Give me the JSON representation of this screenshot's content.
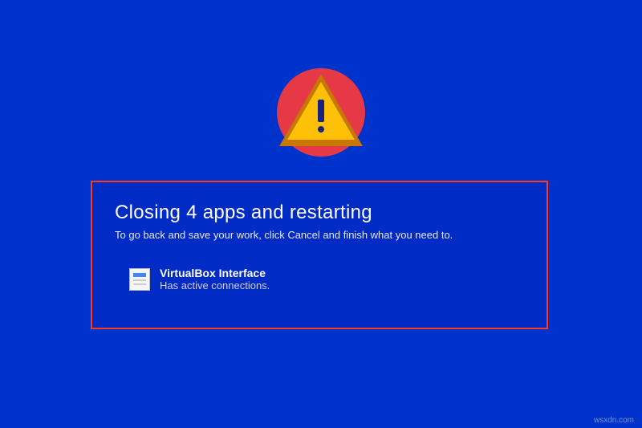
{
  "dialog": {
    "title": "Closing 4 apps and restarting",
    "subtitle": "To go back and save your work, click Cancel and finish what you need to.",
    "app": {
      "name": "VirtualBox Interface",
      "status": "Has active connections."
    }
  },
  "watermark": "wsxdn.com",
  "colors": {
    "background": "#0033cc",
    "highlight_border": "#ff3b1f",
    "warning_circle": "#e63946",
    "warning_triangle": "#ffc107"
  }
}
